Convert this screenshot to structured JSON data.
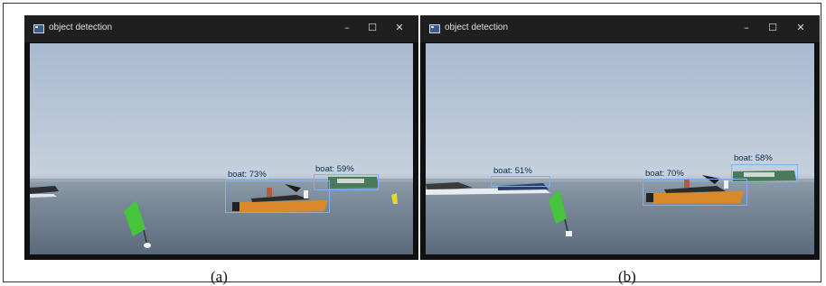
{
  "panels": [
    {
      "window_title": "object detection",
      "caption": "(a)",
      "detections": [
        {
          "label": "boat: 73%"
        },
        {
          "label": "boat: 59%"
        }
      ]
    },
    {
      "window_title": "object detection",
      "caption": "(b)",
      "detections": [
        {
          "label": "boat: 51%"
        },
        {
          "label": "boat: 70%"
        },
        {
          "label": "boat: 58%"
        }
      ]
    }
  ],
  "window_controls": {
    "minimize": "–",
    "maximize": "☐",
    "close": "✕"
  },
  "colors": {
    "box": "#7fb2ea",
    "boat_hull": "#d9892a",
    "flag": "#43c23a",
    "sea": "#7a8a9a",
    "sky": "#b8c6d8"
  }
}
